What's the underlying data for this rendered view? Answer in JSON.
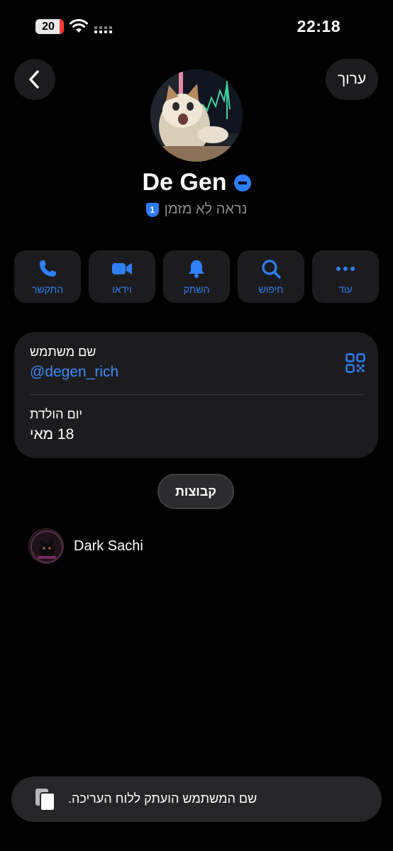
{
  "status_bar": {
    "battery_level": "20",
    "time": "22:18",
    "icons": [
      "battery-icon",
      "wifi-icon",
      "cellular-signal-icon"
    ]
  },
  "header": {
    "back_icon": "chevron-left-icon",
    "edit_label": "ערוך"
  },
  "profile": {
    "name": "De Gen",
    "badge_number": "1",
    "last_seen": "נראה לא מזמן"
  },
  "actions": [
    {
      "icon": "phone-icon",
      "label": "התקשר"
    },
    {
      "icon": "video-icon",
      "label": "וידאו"
    },
    {
      "icon": "bell-icon",
      "label": "השתק"
    },
    {
      "icon": "search-icon",
      "label": "חיפוש"
    },
    {
      "icon": "more-icon",
      "label": "עוד"
    }
  ],
  "info": {
    "username_label": "שם משתמש",
    "username_value": "@degen_rich",
    "birthday_label": "יום הולדת",
    "birthday_value": "18 מאי"
  },
  "groups": {
    "tab_label": "קבוצות",
    "items": [
      {
        "name": "Dark Sachi"
      }
    ]
  },
  "toast": {
    "message": "שם המשתמש הועתק ללוח העריכה."
  },
  "colors": {
    "accent": "#2f7ff6",
    "background": "#000000",
    "card": "#1c1c1e"
  }
}
